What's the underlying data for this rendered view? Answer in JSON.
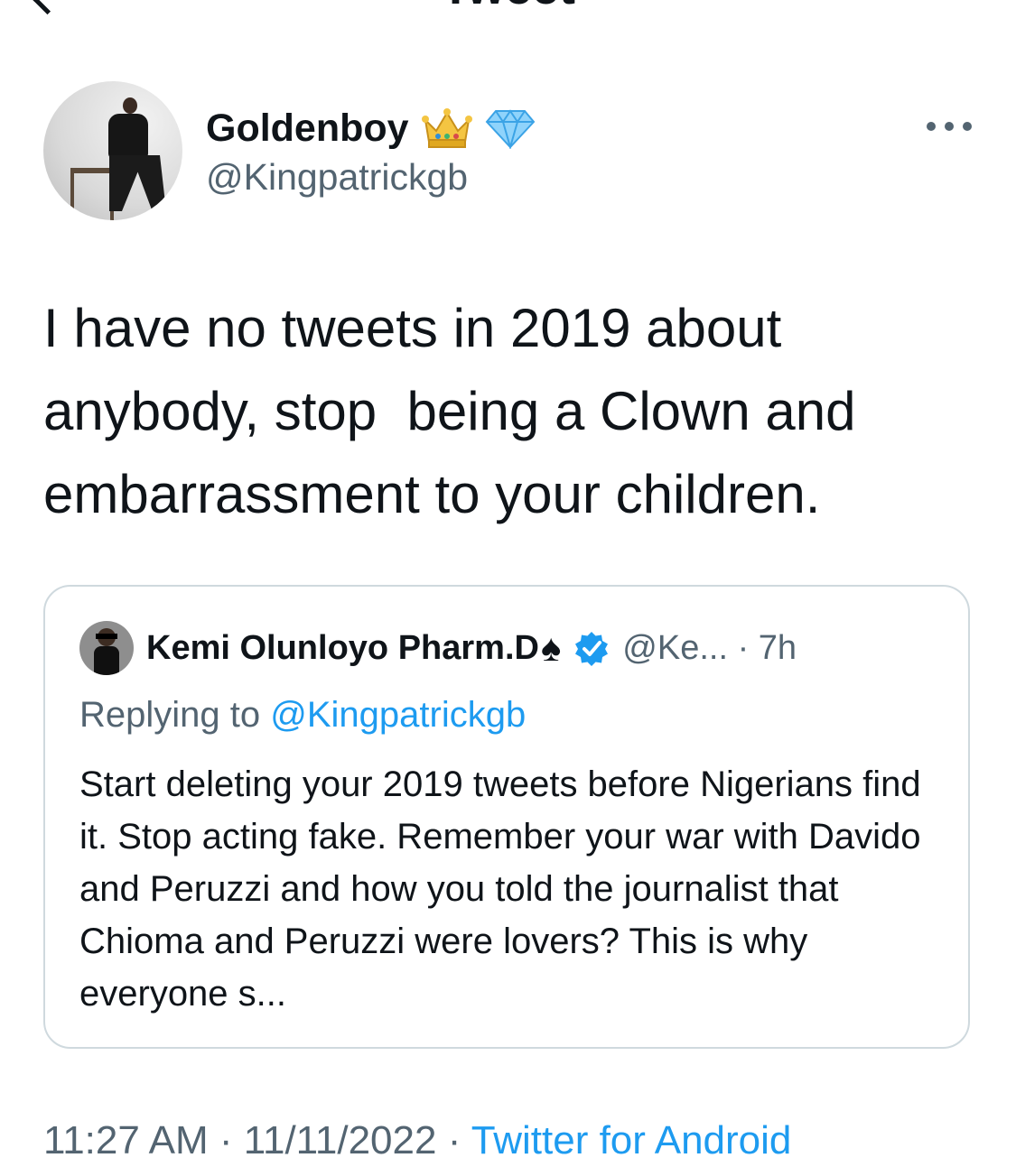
{
  "header": {
    "title": "Tweet"
  },
  "tweet": {
    "author": {
      "name": "Goldenboy",
      "badges": [
        "crown-emoji",
        "gem-emoji"
      ],
      "handle": "@Kingpatrickgb"
    },
    "text": "I have no tweets in 2019 about anybody, stop  being a Clown and embarrassment to your children.",
    "time": "11:27 AM",
    "separator": "·",
    "date": "11/11/2022",
    "source": "Twitter for Android"
  },
  "quoted_tweet": {
    "author": {
      "name": "Kemi Olunloyo Pharm.D",
      "name_suffix_icon": "spade-icon",
      "verified": true,
      "handle": "@Ke...",
      "time": "7h"
    },
    "meta_text": "@Ke... · 7h",
    "replying_prefix": "Replying to",
    "replying_to": "@Kingpatrickgb",
    "text": "Start deleting your 2019 tweets before Nigerians find it. Stop acting fake. Remember your war with Davido and Peruzzi and how you told the journalist that Chioma and Peruzzi were lovers? This is why everyone s..."
  },
  "colors": {
    "text": "#0f1419",
    "secondary": "#536471",
    "accent": "#1d9bf0",
    "border": "#cfd9de"
  }
}
